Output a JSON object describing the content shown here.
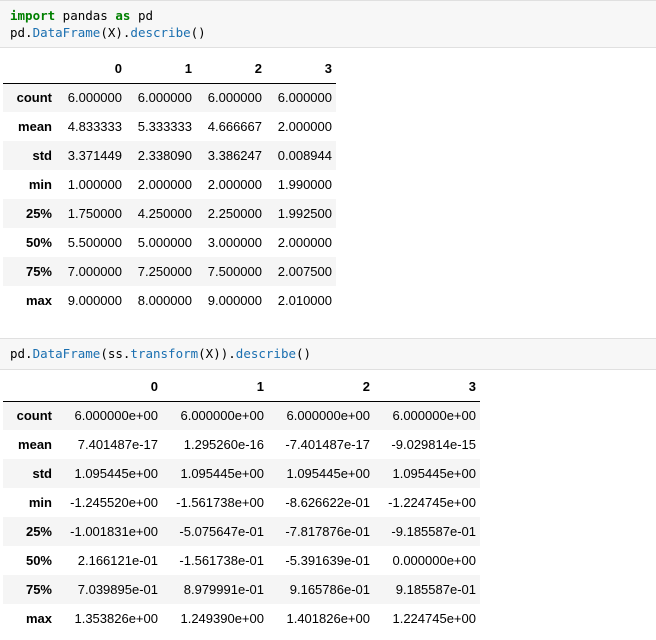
{
  "cell1": {
    "line1": {
      "kw1": "import",
      "mid": " pandas ",
      "kw2": "as",
      "end": " pd"
    },
    "line2": {
      "pre": "pd.",
      "cls": "DataFrame",
      "mid": "(X).",
      "fn": "describe",
      "end": "()"
    }
  },
  "table1": {
    "columns": [
      "0",
      "1",
      "2",
      "3"
    ],
    "rows": [
      {
        "label": "count",
        "values": [
          "6.000000",
          "6.000000",
          "6.000000",
          "6.000000"
        ]
      },
      {
        "label": "mean",
        "values": [
          "4.833333",
          "5.333333",
          "4.666667",
          "2.000000"
        ]
      },
      {
        "label": "std",
        "values": [
          "3.371449",
          "2.338090",
          "3.386247",
          "0.008944"
        ]
      },
      {
        "label": "min",
        "values": [
          "1.000000",
          "2.000000",
          "2.000000",
          "1.990000"
        ]
      },
      {
        "label": "25%",
        "values": [
          "1.750000",
          "4.250000",
          "2.250000",
          "1.992500"
        ]
      },
      {
        "label": "50%",
        "values": [
          "5.500000",
          "5.000000",
          "3.000000",
          "2.000000"
        ]
      },
      {
        "label": "75%",
        "values": [
          "7.000000",
          "7.250000",
          "7.500000",
          "2.007500"
        ]
      },
      {
        "label": "max",
        "values": [
          "9.000000",
          "8.000000",
          "9.000000",
          "2.010000"
        ]
      }
    ]
  },
  "cell2": {
    "line1": {
      "pre": "pd.",
      "cls": "DataFrame",
      "mid1": "(ss.",
      "fn1": "transform",
      "mid2": "(X)).",
      "fn2": "describe",
      "end": "()"
    }
  },
  "table2": {
    "columns": [
      "0",
      "1",
      "2",
      "3"
    ],
    "rows": [
      {
        "label": "count",
        "values": [
          "6.000000e+00",
          "6.000000e+00",
          "6.000000e+00",
          "6.000000e+00"
        ]
      },
      {
        "label": "mean",
        "values": [
          "7.401487e-17",
          "1.295260e-16",
          "-7.401487e-17",
          "-9.029814e-15"
        ]
      },
      {
        "label": "std",
        "values": [
          "1.095445e+00",
          "1.095445e+00",
          "1.095445e+00",
          "1.095445e+00"
        ]
      },
      {
        "label": "min",
        "values": [
          "-1.245520e+00",
          "-1.561738e+00",
          "-8.626622e-01",
          "-1.224745e+00"
        ]
      },
      {
        "label": "25%",
        "values": [
          "-1.001831e+00",
          "-5.075647e-01",
          "-7.817876e-01",
          "-9.185587e-01"
        ]
      },
      {
        "label": "50%",
        "values": [
          "2.166121e-01",
          "-1.561738e-01",
          "-5.391639e-01",
          "0.000000e+00"
        ]
      },
      {
        "label": "75%",
        "values": [
          "7.039895e-01",
          "8.979991e-01",
          "9.165786e-01",
          "9.185587e-01"
        ]
      },
      {
        "label": "max",
        "values": [
          "1.353826e+00",
          "1.249390e+00",
          "1.401826e+00",
          "1.224745e+00"
        ]
      }
    ]
  }
}
